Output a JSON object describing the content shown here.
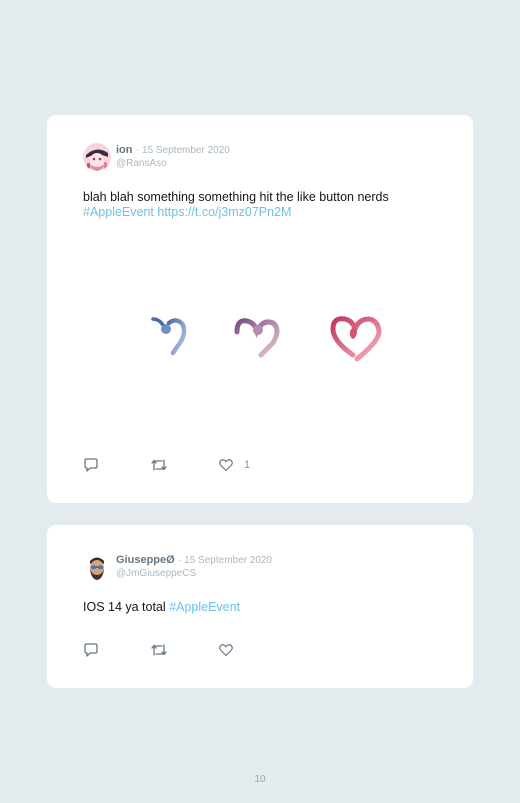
{
  "tweets": [
    {
      "name": "ion",
      "separator": "·",
      "date": "15 September 2020",
      "handle": "@RansAso",
      "text_line1": "blah blah something something hit the like button nerds",
      "text_link1": "#AppleEvent",
      "text_link2": "https://t.co/j3mz07Pn2M",
      "like_count": "1",
      "avatar_icon": "anime-avatar-icon",
      "media_icon": "heart-animation-icon"
    },
    {
      "name": "GiuseppeØ",
      "separator": "·",
      "date": "15 September 2020",
      "handle": "@JmGiuseppeCS",
      "text_plain": "IOS 14 ya total",
      "text_link1": "#AppleEvent",
      "like_count": "",
      "avatar_icon": "memoji-avatar-icon"
    }
  ],
  "page_number": "10",
  "colors": {
    "background": "#e4ebee",
    "card": "#ffffff",
    "link": "#6dc1e6",
    "muted": "#aab8c2",
    "heart_blue": "#6d8fc2",
    "heart_purple": "#9c6d9e",
    "heart_pink": "#d65276"
  }
}
